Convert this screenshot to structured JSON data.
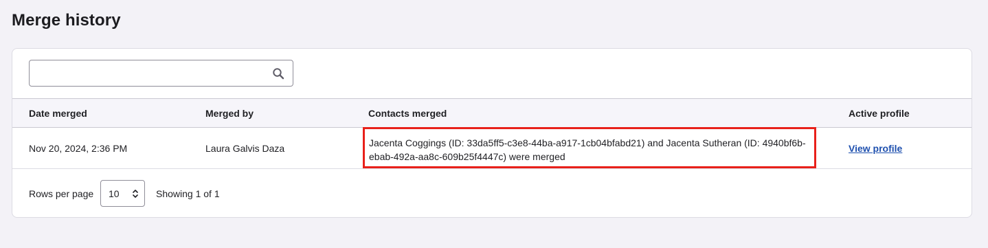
{
  "page": {
    "title": "Merge history"
  },
  "search": {
    "value": "",
    "placeholder": "",
    "icon": "search-icon"
  },
  "table": {
    "columns": [
      "Date merged",
      "Merged by",
      "Contacts merged",
      "Active profile"
    ],
    "rows": [
      {
        "date_merged": "Nov 20, 2024, 2:36 PM",
        "merged_by": "Laura Galvis Daza",
        "contacts_merged": "Jacenta Coggings (ID: 33da5ff5-c3e8-44ba-a917-1cb04bfabd21) and Jacenta Sutheran (ID: 4940bf6b-ebab-492a-aa8c-609b25f4447c) were merged",
        "active_profile_link": "View profile"
      }
    ]
  },
  "pagination": {
    "rows_per_page_label": "Rows per page",
    "rows_per_page_value": "10",
    "showing_text": "Showing 1 of 1"
  },
  "colors": {
    "background": "#f3f2f7",
    "card": "#ffffff",
    "header_row": "#f6f5fa",
    "link": "#1d4fae",
    "highlight_border": "#e8201a"
  }
}
